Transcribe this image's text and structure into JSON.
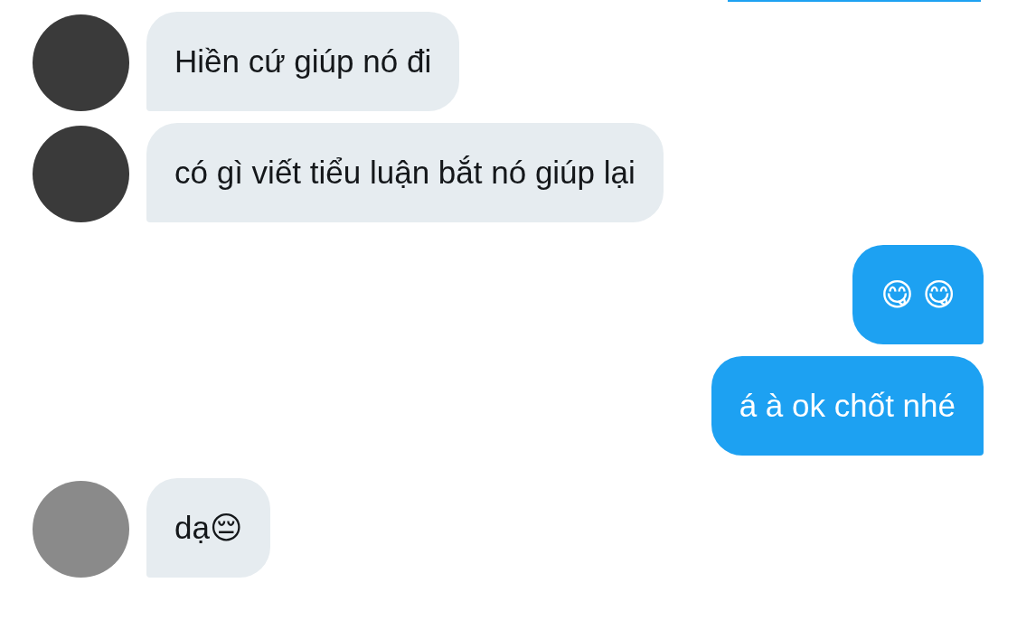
{
  "messages": [
    {
      "outgoing": false,
      "text": "Hiền cứ giúp nó đi"
    },
    {
      "outgoing": false,
      "text": "có gì viết tiểu luận bắt nó giúp lại"
    },
    {
      "outgoing": true,
      "text": "😋 😋"
    },
    {
      "outgoing": true,
      "text": "á à ok chốt nhé"
    },
    {
      "outgoing": false,
      "text": "dạ😔"
    }
  ]
}
